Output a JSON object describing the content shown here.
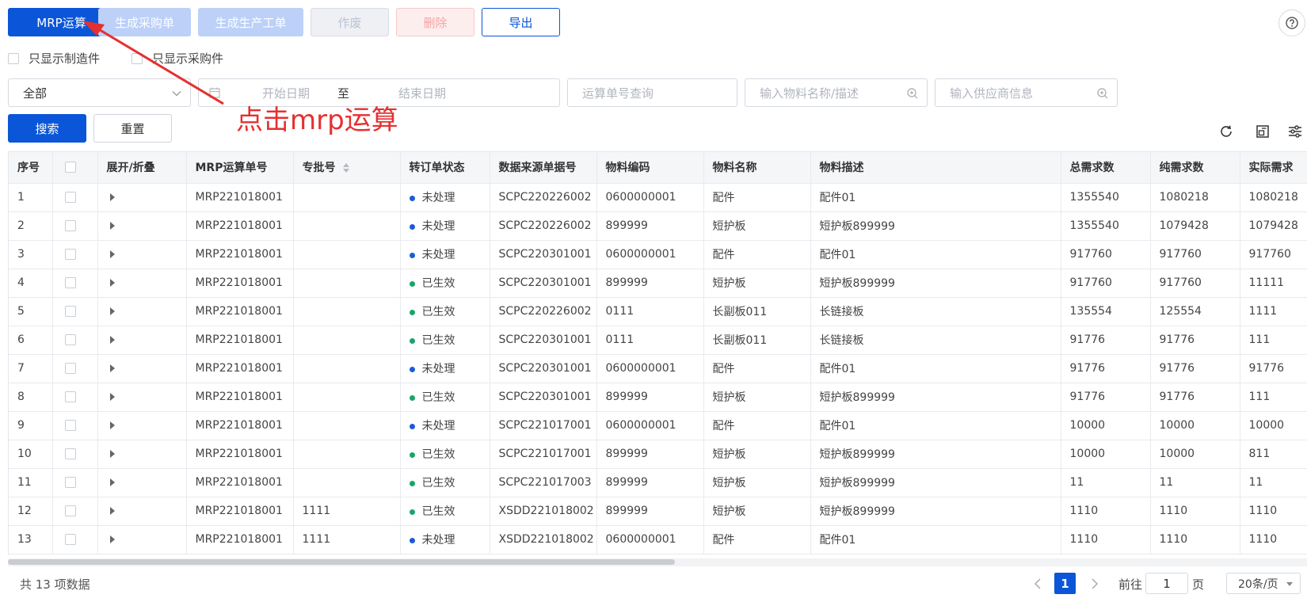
{
  "toolbar": {
    "mrp": "MRP运算",
    "gen_purchase": "生成采购单",
    "gen_work_order": "生成生产工单",
    "void": "作废",
    "delete": "删除",
    "export": "导出"
  },
  "filters": {
    "only_manufactured": "只显示制造件",
    "only_purchased": "只显示采购件",
    "scope_value": "全部",
    "start_date": "开始日期",
    "date_sep": "至",
    "end_date": "结束日期",
    "mrp_no_placeholder": "运算单号查询",
    "material_placeholder": "输入物料名称/描述",
    "supplier_placeholder": "输入供应商信息"
  },
  "actions": {
    "search": "搜索",
    "reset": "重置"
  },
  "annotation": "点击mrp运算",
  "table": {
    "headers": [
      "序号",
      "",
      "展开/折叠",
      "MRP运算单号",
      "专批号",
      "转订单状态",
      "数据来源单据号",
      "物料编码",
      "物料名称",
      "物料描述",
      "总需求数",
      "纯需求数",
      "实际需求"
    ],
    "rows": [
      [
        "1",
        "MRP221018001",
        "",
        "未处理",
        "SCPC220226002",
        "0600000001",
        "配件",
        "配件01",
        "1355540",
        "1080218",
        "1080218"
      ],
      [
        "2",
        "MRP221018001",
        "",
        "未处理",
        "SCPC220226002",
        "899999",
        "短护板",
        "短护板899999",
        "1355540",
        "1079428",
        "1079428"
      ],
      [
        "3",
        "MRP221018001",
        "",
        "未处理",
        "SCPC220301001",
        "0600000001",
        "配件",
        "配件01",
        "917760",
        "917760",
        "917760"
      ],
      [
        "4",
        "MRP221018001",
        "",
        "已生效",
        "SCPC220301001",
        "899999",
        "短护板",
        "短护板899999",
        "917760",
        "917760",
        "11111"
      ],
      [
        "5",
        "MRP221018001",
        "",
        "已生效",
        "SCPC220226002",
        "0111",
        "长副板011",
        "长链接板",
        "135554",
        "125554",
        "1111"
      ],
      [
        "6",
        "MRP221018001",
        "",
        "已生效",
        "SCPC220301001",
        "0111",
        "长副板011",
        "长链接板",
        "91776",
        "91776",
        "111"
      ],
      [
        "7",
        "MRP221018001",
        "",
        "未处理",
        "SCPC220301001",
        "0600000001",
        "配件",
        "配件01",
        "91776",
        "91776",
        "91776"
      ],
      [
        "8",
        "MRP221018001",
        "",
        "已生效",
        "SCPC220301001",
        "899999",
        "短护板",
        "短护板899999",
        "91776",
        "91776",
        "111"
      ],
      [
        "9",
        "MRP221018001",
        "",
        "未处理",
        "SCPC221017001",
        "0600000001",
        "配件",
        "配件01",
        "10000",
        "10000",
        "10000"
      ],
      [
        "10",
        "MRP221018001",
        "",
        "已生效",
        "SCPC221017001",
        "899999",
        "短护板",
        "短护板899999",
        "10000",
        "10000",
        "811"
      ],
      [
        "11",
        "MRP221018001",
        "",
        "已生效",
        "SCPC221017003",
        "899999",
        "短护板",
        "短护板899999",
        "11",
        "11",
        "11"
      ],
      [
        "12",
        "MRP221018001",
        "1111",
        "已生效",
        "XSDD221018002",
        "899999",
        "短护板",
        "短护板899999",
        "1110",
        "1110",
        "1110"
      ],
      [
        "13",
        "MRP221018001",
        "1111",
        "未处理",
        "XSDD221018002",
        "0600000001",
        "配件",
        "配件01",
        "1110",
        "1110",
        "1110"
      ]
    ]
  },
  "status_colors": {
    "未处理": "#1d5bd6",
    "已生效": "#19a56a"
  },
  "pagination": {
    "total": "共 13 项数据",
    "current": "1",
    "goto_label": "前往",
    "goto_value": "1",
    "page_unit": "页",
    "page_size": "20条/页"
  }
}
